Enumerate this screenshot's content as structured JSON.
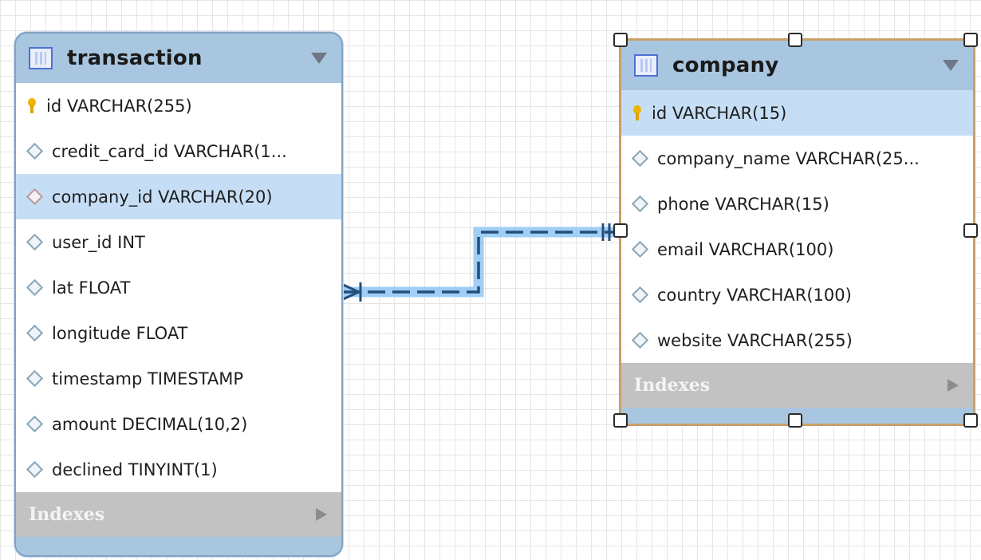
{
  "entities": {
    "transaction": {
      "title": "transaction",
      "columns": [
        {
          "text": "id VARCHAR(255)",
          "icon": "primary-key-icon"
        },
        {
          "text": "credit_card_id VARCHAR(1...",
          "icon": "column-diamond-icon"
        },
        {
          "text": "company_id VARCHAR(20)",
          "icon": "foreign-key-diamond-icon",
          "highlighted": true
        },
        {
          "text": "user_id INT",
          "icon": "column-diamond-icon"
        },
        {
          "text": "lat FLOAT",
          "icon": "column-diamond-icon"
        },
        {
          "text": "longitude FLOAT",
          "icon": "column-diamond-icon"
        },
        {
          "text": "timestamp TIMESTAMP",
          "icon": "column-diamond-icon"
        },
        {
          "text": "amount DECIMAL(10,2)",
          "icon": "column-diamond-icon"
        },
        {
          "text": "declined TINYINT(1)",
          "icon": "column-diamond-icon"
        }
      ],
      "indexes_label": "Indexes"
    },
    "company": {
      "title": "company",
      "columns": [
        {
          "text": "id VARCHAR(15)",
          "icon": "primary-key-icon",
          "highlighted": true
        },
        {
          "text": "company_name VARCHAR(25...",
          "icon": "column-diamond-icon"
        },
        {
          "text": "phone VARCHAR(15)",
          "icon": "column-diamond-icon"
        },
        {
          "text": "email VARCHAR(100)",
          "icon": "column-diamond-icon"
        },
        {
          "text": "country VARCHAR(100)",
          "icon": "column-diamond-icon"
        },
        {
          "text": "website VARCHAR(255)",
          "icon": "column-diamond-icon"
        }
      ],
      "indexes_label": "Indexes",
      "selected": true
    }
  },
  "relationship": {
    "from": "transaction",
    "to": "company",
    "from_cardinality": "many",
    "to_cardinality": "one",
    "line_style": "dashed",
    "highlight_color": "#6fb6f0",
    "line_color": "#234e7a"
  },
  "colors": {
    "header_blue": "#a9c6e0",
    "row_highlight": "#c5def5",
    "selection_border": "#c9a06a",
    "indexes_gray": "#c2c2c2"
  }
}
